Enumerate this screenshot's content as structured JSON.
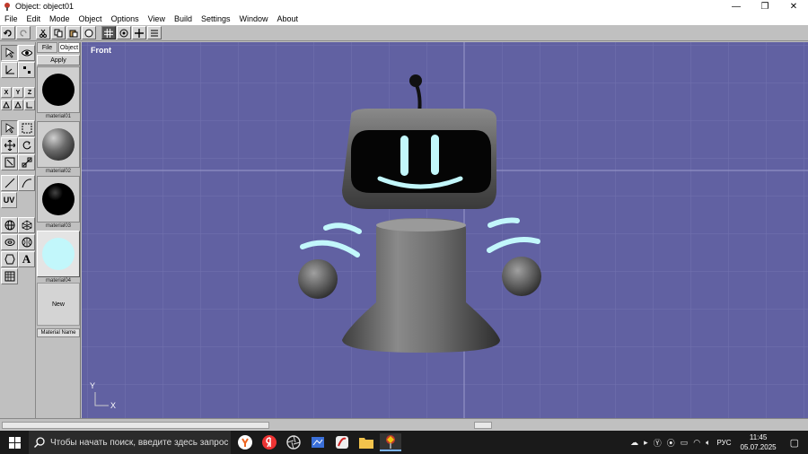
{
  "window": {
    "title": "Object: object01",
    "controls": {
      "minimize": "—",
      "restore": "❐",
      "close": "✕"
    }
  },
  "menu": {
    "items": [
      "File",
      "Edit",
      "Mode",
      "Object",
      "Options",
      "View",
      "Build",
      "Settings",
      "Window",
      "About"
    ]
  },
  "toolbar": {
    "icons": [
      "undo-icon",
      "redo-icon",
      "cut-icon",
      "copy-icon",
      "paste-icon",
      "sphere-icon",
      "grid-icon",
      "wheel-icon",
      "move-icon",
      "list-icon"
    ]
  },
  "left_tools": {
    "axis_labels": [
      "X",
      "Y",
      "Z"
    ],
    "uv_label": "UV",
    "text_tool": "A"
  },
  "material_panel": {
    "tabs": [
      "File",
      "Object"
    ],
    "apply_label": "Apply",
    "materials": [
      {
        "label": "material01",
        "color": "#000000",
        "style": "flat"
      },
      {
        "label": "material02",
        "color": "#6a6a6a",
        "style": "shaded"
      },
      {
        "label": "material03",
        "color": "#000000",
        "style": "glossy"
      },
      {
        "label": "material04",
        "color": "#c2f7fb",
        "style": "flat"
      }
    ],
    "new_label": "New",
    "material_name_label": "Material Name"
  },
  "viewport": {
    "label": "Front",
    "axis_y": "Y",
    "axis_x": "X",
    "background": "#6161a2"
  },
  "taskbar": {
    "search_placeholder": "Чтобы начать поиск, введите здесь запрос",
    "language": "РУС",
    "time": "11:45",
    "date": "05.07.2025"
  }
}
